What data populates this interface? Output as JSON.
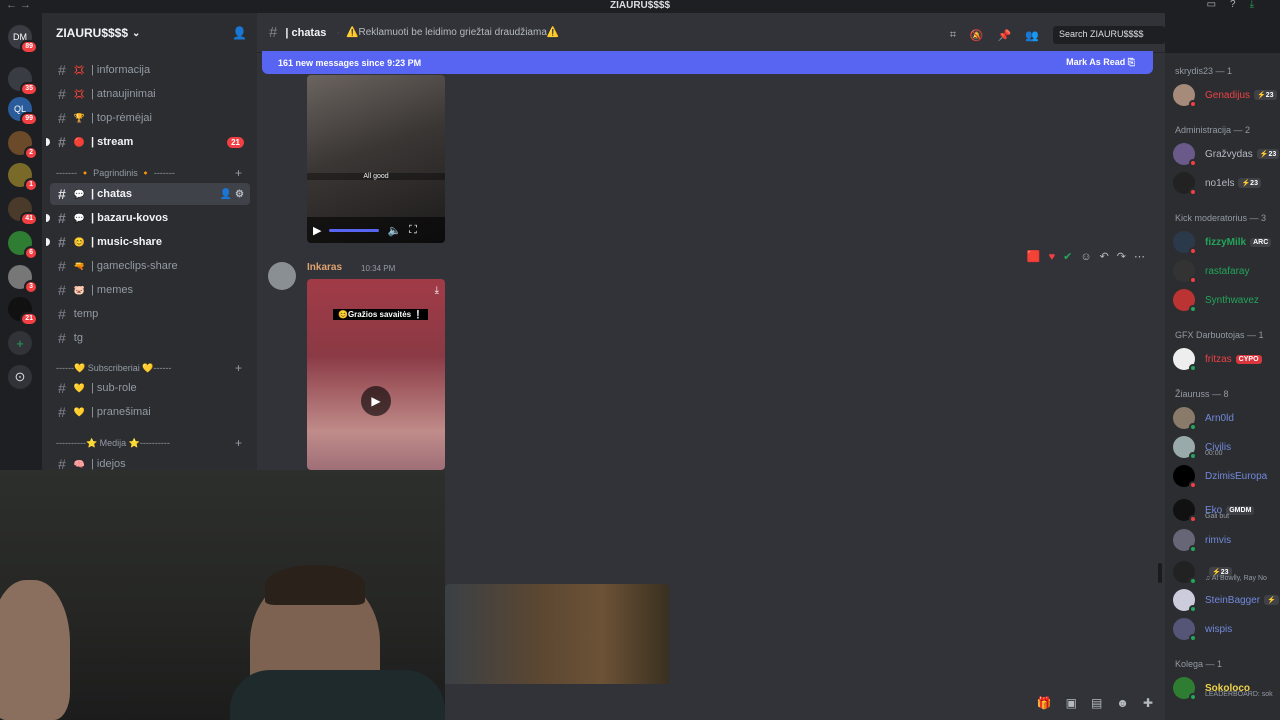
{
  "window": {
    "title": "ZIAURU$$$$"
  },
  "rail": {
    "servers": [
      {
        "label": "DM",
        "badge": "89"
      },
      {
        "label": "",
        "badge": "35"
      },
      {
        "label": "QL",
        "badge": "99"
      },
      {
        "label": "",
        "badge": "2"
      },
      {
        "label": "",
        "badge": "1"
      },
      {
        "label": "",
        "badge": "41"
      },
      {
        "label": "",
        "badge": "6"
      },
      {
        "label": "",
        "badge": "3"
      },
      {
        "label": "",
        "badge": "21"
      }
    ],
    "add": "+",
    "explore": "⊙"
  },
  "server": {
    "name": "ZIAURU$$$$"
  },
  "channels": [
    {
      "name": "| informacija",
      "emoji": "💢"
    },
    {
      "name": "| atnaujinimai",
      "emoji": "💢"
    },
    {
      "name": "| top-rėmėjai",
      "emoji": "🏆"
    },
    {
      "name": "| stream",
      "emoji": "🔴",
      "count": "21"
    },
    {
      "name": "| chatas",
      "emoji": "💬"
    },
    {
      "name": "| bazaru-kovos",
      "emoji": "💬"
    },
    {
      "name": "| music-share",
      "emoji": "😊"
    },
    {
      "name": "| gameclips-share",
      "emoji": "🔫"
    },
    {
      "name": "| memes",
      "emoji": "🐷"
    },
    {
      "name": "temp",
      "emoji": ""
    },
    {
      "name": "tg",
      "emoji": ""
    },
    {
      "name": "| sub-role",
      "emoji": "💛"
    },
    {
      "name": "| pranešimai",
      "emoji": "💛"
    },
    {
      "name": "| idejos",
      "emoji": "🧠"
    }
  ],
  "categories": {
    "pagrindinis": "------- 🔸 Pagrindinis 🔸 -------",
    "subscriberiai": "------💛 Subscriberiai 💛------",
    "medija": "----------⭐ Medija ⭐----------"
  },
  "chat": {
    "channel_name": "| chatas",
    "topic": "⚠️Reklamuoti be leidimo griežtai draudžiama⚠️",
    "search_placeholder": "Search ZIAURU$$$$",
    "new_messages": "161 new messages since 9:23 PM",
    "mark_as_read": "Mark As Read",
    "video1_caption": "All good",
    "message": {
      "author": "Inkaras",
      "time": "10:34 PM",
      "video_caption": "😊Gražios savaitės ❕"
    }
  },
  "members": {
    "groups": [
      {
        "title": "skrydis23 — 1"
      },
      {
        "title": "Administracija — 2"
      },
      {
        "title": "Kick moderatorius — 3"
      },
      {
        "title": "GFX Darbuotojas — 1"
      },
      {
        "title": "Žiauruss — 8"
      },
      {
        "title": "Kolega — 1"
      }
    ],
    "list": [
      {
        "name": "Genadijus",
        "color": "#ed4245",
        "tag": "⚡23"
      },
      {
        "name": "Gražvydas",
        "color": "#b5bac1",
        "tag": "⚡23"
      },
      {
        "name": "no1els",
        "color": "#b5bac1",
        "tag": "⚡23"
      },
      {
        "name": "fizzyMilk",
        "color": "#23a55a",
        "tag": "ARC"
      },
      {
        "name": "rastafaray",
        "color": "#23a55a",
        "tag": ""
      },
      {
        "name": "Synthwavez",
        "color": "#23a55a",
        "tag": ""
      },
      {
        "name": "fritzas",
        "color": "#ed4245",
        "tag": "CYPO"
      },
      {
        "name": "Arn0ld",
        "color": "#7289da",
        "tag": ""
      },
      {
        "name": "Civilis",
        "color": "#7289da",
        "tag": "",
        "sub": "00:00"
      },
      {
        "name": "DzimisEuropa",
        "color": "#7289da",
        "tag": ""
      },
      {
        "name": "Eko",
        "color": "#7289da",
        "tag": "GMDM",
        "sub": "Gali but"
      },
      {
        "name": "rimvis",
        "color": "#7289da",
        "tag": ""
      },
      {
        "name": "",
        "color": "#7289da",
        "tag": "⚡23",
        "sub": "♫ Al Bowlly, Ray No"
      },
      {
        "name": "SteinBagger",
        "color": "#7289da",
        "tag": "⚡"
      },
      {
        "name": "wispis",
        "color": "#7289da",
        "tag": ""
      },
      {
        "name": "Sokoloco",
        "color": "#f0d34a",
        "tag": "",
        "sub": "LEADERBOARD: sok"
      }
    ]
  }
}
